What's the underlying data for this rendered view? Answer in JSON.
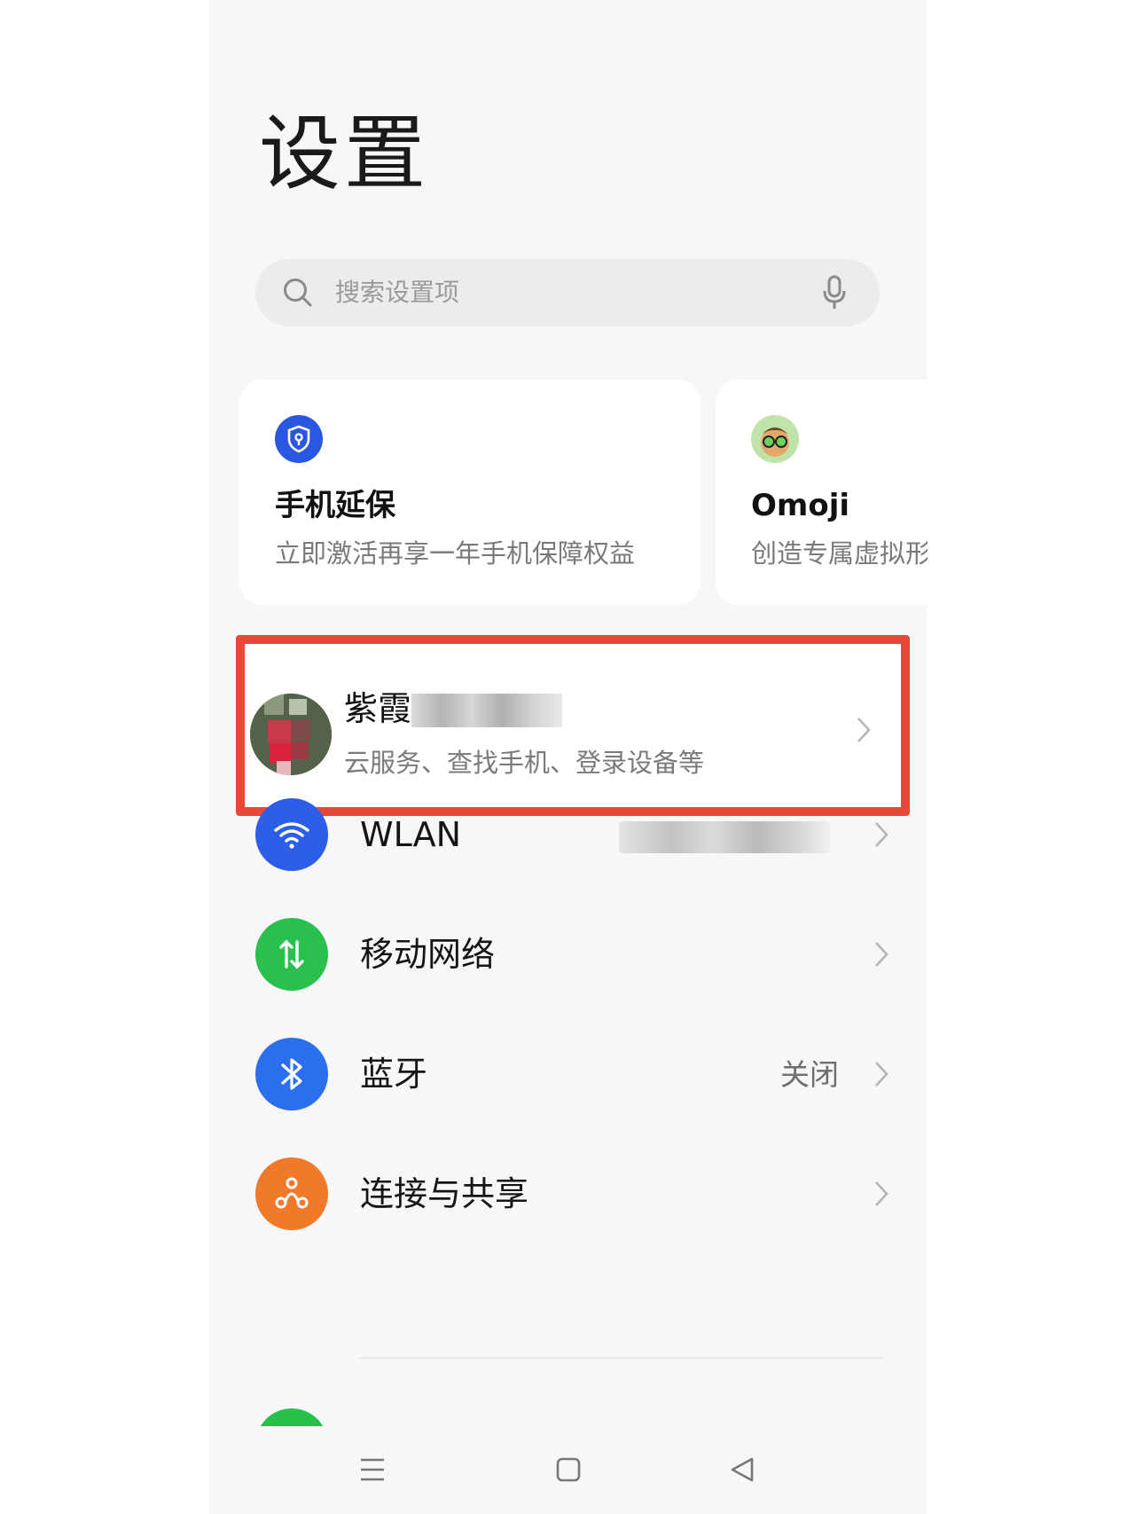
{
  "page": {
    "title": "设置"
  },
  "search": {
    "placeholder": "搜索设置项",
    "icon": "search-icon",
    "mic_icon": "microphone-icon"
  },
  "cards": [
    {
      "title": "手机延保",
      "subtitle": "立即激活再享一年手机保障权益",
      "icon": "shield-icon",
      "icon_color": "#2a57e0"
    },
    {
      "title": "Omoji",
      "subtitle": "创造专属虚拟形象",
      "icon": "omoji-avatar-icon",
      "icon_color": "#6cbf4c"
    }
  ],
  "account": {
    "name": "紫霞",
    "subtitle": "云服务、查找手机、登录设备等",
    "highlight_color": "#e8483a"
  },
  "settings": [
    {
      "label": "WLAN",
      "value": "",
      "icon": "wifi-icon",
      "color": "#2d5ee8"
    },
    {
      "label": "移动网络",
      "value": "",
      "icon": "mobile-data-icon",
      "color": "#2ac04e"
    },
    {
      "label": "蓝牙",
      "value": "关闭",
      "icon": "bluetooth-icon",
      "color": "#2b6fef"
    },
    {
      "label": "连接与共享",
      "value": "",
      "icon": "share-icon",
      "color": "#f07a2a"
    }
  ],
  "nav": {
    "menu": "menu-icon",
    "home": "home-icon",
    "back": "back-icon"
  }
}
